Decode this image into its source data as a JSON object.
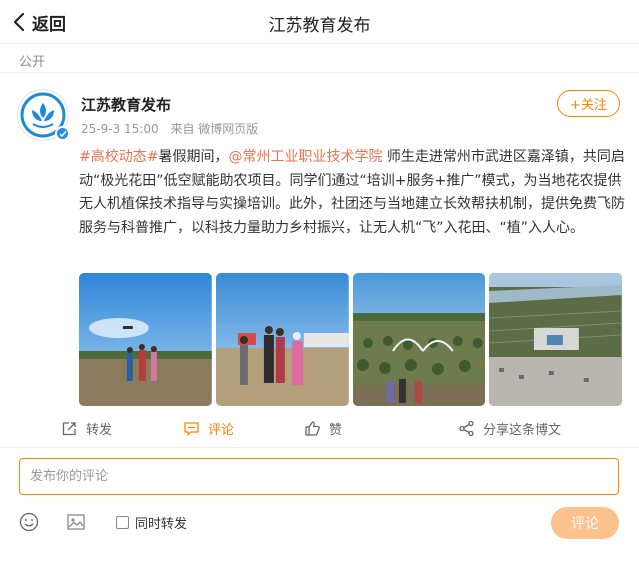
{
  "header": {
    "back_label": "返回",
    "title": "江苏教育发布"
  },
  "post": {
    "visibility": "公开",
    "author": "江苏教育发布",
    "time": "25-9-3 15:00",
    "source": "来自 微博网页版",
    "follow_label": "+关注",
    "topic": "#高校动态#",
    "text_a": "暑假期间，",
    "mention": "@常州工业职业技术学院",
    "text_b": " 师生走进常州市武进区嘉泽镇，共同启动“极光花田”低空赋能助农项目。同学们通过“培训+服务+推广”模式，为当地花农提供无人机植保技术指导与实操培训。此外，社团还与当地建立长效帮扶机制，提供免费飞防服务与科普推广，以科技力量助力乡村振兴，让无人机“飞”入花田、“植”入人心。"
  },
  "actions": {
    "repost": "转发",
    "comment": "评论",
    "like": "赞",
    "share": "分享这条博文"
  },
  "composer": {
    "placeholder": "发布你的评论",
    "repost_checkbox": "同时转发",
    "submit": "评论"
  },
  "icons": {
    "back": "chevron-left-icon",
    "verified": "verified-badge-icon",
    "repost": "repost-icon",
    "comment": "comment-icon",
    "like": "thumbs-up-icon",
    "share": "share-icon",
    "emoji": "emoji-icon",
    "image": "image-icon"
  },
  "colors": {
    "accent": "#ff8200",
    "link": "#eb7350",
    "submit_disabled": "#fcc28e"
  }
}
